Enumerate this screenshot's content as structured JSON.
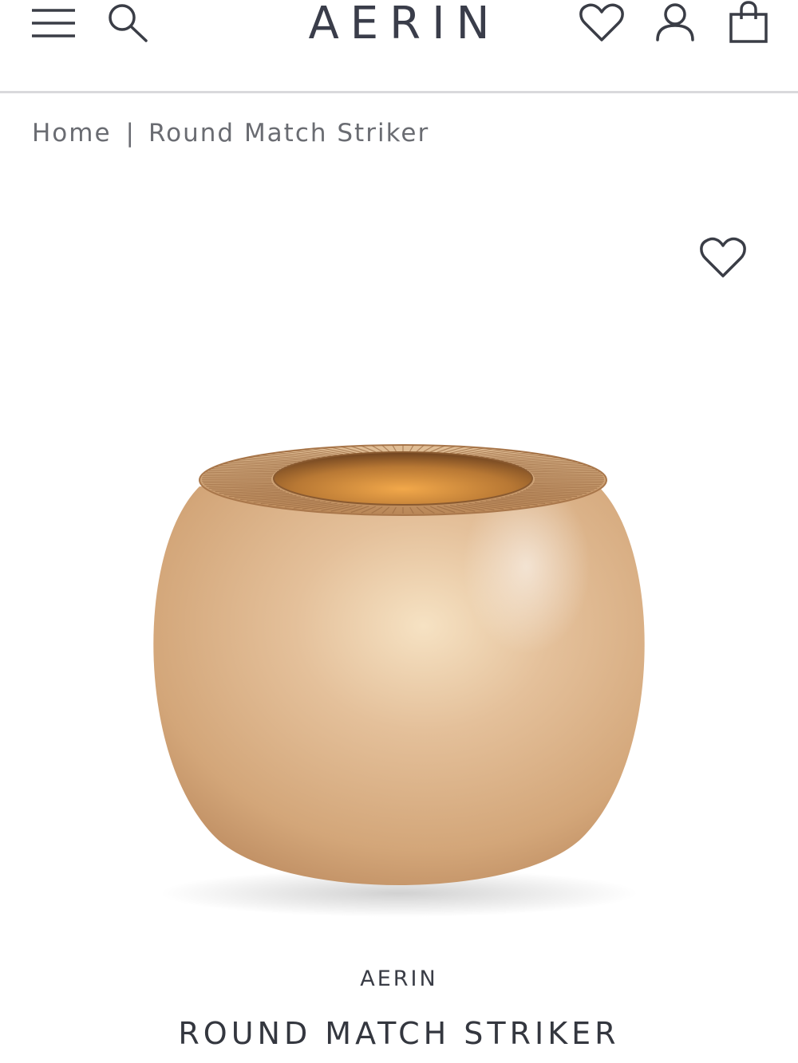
{
  "header": {
    "logo": "AERIN",
    "icons": {
      "menu": "hamburger-menu-icon",
      "search": "search-icon",
      "wishlist": "heart-icon",
      "account": "user-icon",
      "cart": "shopping-bag-icon"
    }
  },
  "breadcrumb": {
    "home": "Home",
    "separator": "|",
    "current": "Round Match Striker"
  },
  "product": {
    "image_alt": "Gold round match striker",
    "wishlist_icon": "heart-icon",
    "brand": "AERIN",
    "title": "ROUND MATCH STRIKER",
    "colors": {
      "gold_light": "#f1d9b6",
      "gold_mid": "#dcb389",
      "gold_dark": "#b27d4f"
    }
  }
}
